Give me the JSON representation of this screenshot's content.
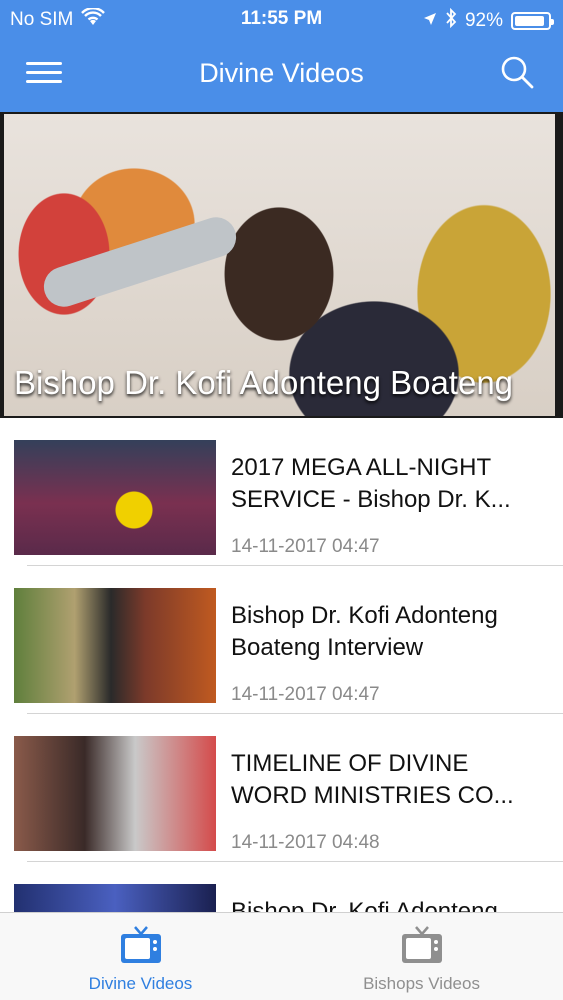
{
  "status_bar": {
    "carrier": "No SIM",
    "time": "11:55 PM",
    "battery": "92%",
    "battery_level": 0.92,
    "icons": [
      "wifi-icon",
      "location-arrow-icon",
      "bluetooth-icon",
      "battery-icon"
    ]
  },
  "nav": {
    "title": "Divine Videos",
    "left_icon": "menu-icon",
    "right_icon": "search-icon"
  },
  "featured": {
    "title": "Bishop Dr. Kofi Adonteng Boateng"
  },
  "videos": [
    {
      "title": "2017 MEGA ALL-NIGHT\nSERVICE - Bishop Dr. K...",
      "date": "14-11-2017 04:47"
    },
    {
      "title": "Bishop Dr. Kofi Adonteng\nBoateng  Interview",
      "date": "14-11-2017 04:47"
    },
    {
      "title": "TIMELINE OF DIVINE\nWORD MINISTRIES CO...",
      "date": "14-11-2017 04:48"
    },
    {
      "title": "Bishop Dr. Kofi Adonteng",
      "date": ""
    }
  ],
  "tabs": [
    {
      "label": "Divine Videos",
      "icon": "tv-icon",
      "active": true
    },
    {
      "label": "Bishops Videos",
      "icon": "tv-icon",
      "active": false
    }
  ],
  "colors": {
    "header": "#4a8ee8",
    "tab_active": "#2f7fe0",
    "tab_inactive": "#8f8f8f"
  }
}
